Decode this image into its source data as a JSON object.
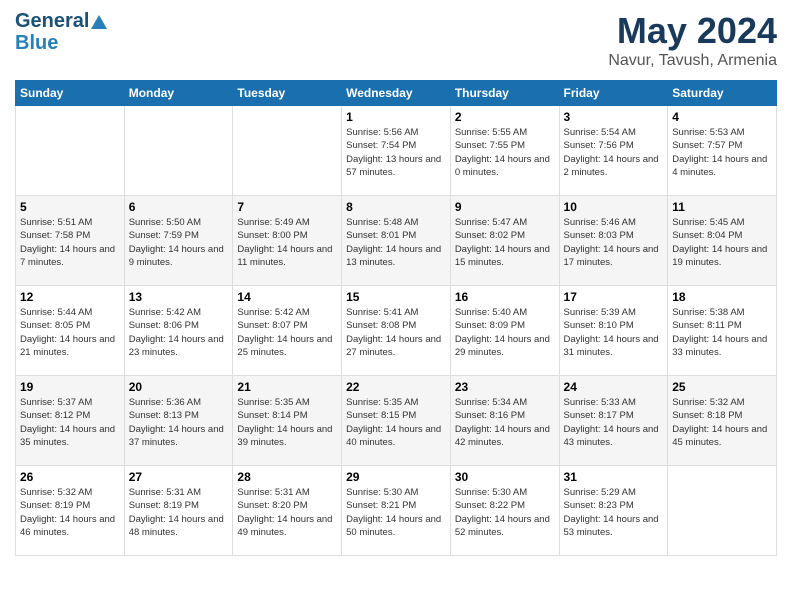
{
  "logo": {
    "line1": "General",
    "line2": "Blue"
  },
  "title": "May 2024",
  "subtitle": "Navur, Tavush, Armenia",
  "days_of_week": [
    "Sunday",
    "Monday",
    "Tuesday",
    "Wednesday",
    "Thursday",
    "Friday",
    "Saturday"
  ],
  "weeks": [
    [
      {
        "day": "",
        "sunrise": "",
        "sunset": "",
        "daylight": ""
      },
      {
        "day": "",
        "sunrise": "",
        "sunset": "",
        "daylight": ""
      },
      {
        "day": "",
        "sunrise": "",
        "sunset": "",
        "daylight": ""
      },
      {
        "day": "1",
        "sunrise": "Sunrise: 5:56 AM",
        "sunset": "Sunset: 7:54 PM",
        "daylight": "Daylight: 13 hours and 57 minutes."
      },
      {
        "day": "2",
        "sunrise": "Sunrise: 5:55 AM",
        "sunset": "Sunset: 7:55 PM",
        "daylight": "Daylight: 14 hours and 0 minutes."
      },
      {
        "day": "3",
        "sunrise": "Sunrise: 5:54 AM",
        "sunset": "Sunset: 7:56 PM",
        "daylight": "Daylight: 14 hours and 2 minutes."
      },
      {
        "day": "4",
        "sunrise": "Sunrise: 5:53 AM",
        "sunset": "Sunset: 7:57 PM",
        "daylight": "Daylight: 14 hours and 4 minutes."
      }
    ],
    [
      {
        "day": "5",
        "sunrise": "Sunrise: 5:51 AM",
        "sunset": "Sunset: 7:58 PM",
        "daylight": "Daylight: 14 hours and 7 minutes."
      },
      {
        "day": "6",
        "sunrise": "Sunrise: 5:50 AM",
        "sunset": "Sunset: 7:59 PM",
        "daylight": "Daylight: 14 hours and 9 minutes."
      },
      {
        "day": "7",
        "sunrise": "Sunrise: 5:49 AM",
        "sunset": "Sunset: 8:00 PM",
        "daylight": "Daylight: 14 hours and 11 minutes."
      },
      {
        "day": "8",
        "sunrise": "Sunrise: 5:48 AM",
        "sunset": "Sunset: 8:01 PM",
        "daylight": "Daylight: 14 hours and 13 minutes."
      },
      {
        "day": "9",
        "sunrise": "Sunrise: 5:47 AM",
        "sunset": "Sunset: 8:02 PM",
        "daylight": "Daylight: 14 hours and 15 minutes."
      },
      {
        "day": "10",
        "sunrise": "Sunrise: 5:46 AM",
        "sunset": "Sunset: 8:03 PM",
        "daylight": "Daylight: 14 hours and 17 minutes."
      },
      {
        "day": "11",
        "sunrise": "Sunrise: 5:45 AM",
        "sunset": "Sunset: 8:04 PM",
        "daylight": "Daylight: 14 hours and 19 minutes."
      }
    ],
    [
      {
        "day": "12",
        "sunrise": "Sunrise: 5:44 AM",
        "sunset": "Sunset: 8:05 PM",
        "daylight": "Daylight: 14 hours and 21 minutes."
      },
      {
        "day": "13",
        "sunrise": "Sunrise: 5:42 AM",
        "sunset": "Sunset: 8:06 PM",
        "daylight": "Daylight: 14 hours and 23 minutes."
      },
      {
        "day": "14",
        "sunrise": "Sunrise: 5:42 AM",
        "sunset": "Sunset: 8:07 PM",
        "daylight": "Daylight: 14 hours and 25 minutes."
      },
      {
        "day": "15",
        "sunrise": "Sunrise: 5:41 AM",
        "sunset": "Sunset: 8:08 PM",
        "daylight": "Daylight: 14 hours and 27 minutes."
      },
      {
        "day": "16",
        "sunrise": "Sunrise: 5:40 AM",
        "sunset": "Sunset: 8:09 PM",
        "daylight": "Daylight: 14 hours and 29 minutes."
      },
      {
        "day": "17",
        "sunrise": "Sunrise: 5:39 AM",
        "sunset": "Sunset: 8:10 PM",
        "daylight": "Daylight: 14 hours and 31 minutes."
      },
      {
        "day": "18",
        "sunrise": "Sunrise: 5:38 AM",
        "sunset": "Sunset: 8:11 PM",
        "daylight": "Daylight: 14 hours and 33 minutes."
      }
    ],
    [
      {
        "day": "19",
        "sunrise": "Sunrise: 5:37 AM",
        "sunset": "Sunset: 8:12 PM",
        "daylight": "Daylight: 14 hours and 35 minutes."
      },
      {
        "day": "20",
        "sunrise": "Sunrise: 5:36 AM",
        "sunset": "Sunset: 8:13 PM",
        "daylight": "Daylight: 14 hours and 37 minutes."
      },
      {
        "day": "21",
        "sunrise": "Sunrise: 5:35 AM",
        "sunset": "Sunset: 8:14 PM",
        "daylight": "Daylight: 14 hours and 39 minutes."
      },
      {
        "day": "22",
        "sunrise": "Sunrise: 5:35 AM",
        "sunset": "Sunset: 8:15 PM",
        "daylight": "Daylight: 14 hours and 40 minutes."
      },
      {
        "day": "23",
        "sunrise": "Sunrise: 5:34 AM",
        "sunset": "Sunset: 8:16 PM",
        "daylight": "Daylight: 14 hours and 42 minutes."
      },
      {
        "day": "24",
        "sunrise": "Sunrise: 5:33 AM",
        "sunset": "Sunset: 8:17 PM",
        "daylight": "Daylight: 14 hours and 43 minutes."
      },
      {
        "day": "25",
        "sunrise": "Sunrise: 5:32 AM",
        "sunset": "Sunset: 8:18 PM",
        "daylight": "Daylight: 14 hours and 45 minutes."
      }
    ],
    [
      {
        "day": "26",
        "sunrise": "Sunrise: 5:32 AM",
        "sunset": "Sunset: 8:19 PM",
        "daylight": "Daylight: 14 hours and 46 minutes."
      },
      {
        "day": "27",
        "sunrise": "Sunrise: 5:31 AM",
        "sunset": "Sunset: 8:19 PM",
        "daylight": "Daylight: 14 hours and 48 minutes."
      },
      {
        "day": "28",
        "sunrise": "Sunrise: 5:31 AM",
        "sunset": "Sunset: 8:20 PM",
        "daylight": "Daylight: 14 hours and 49 minutes."
      },
      {
        "day": "29",
        "sunrise": "Sunrise: 5:30 AM",
        "sunset": "Sunset: 8:21 PM",
        "daylight": "Daylight: 14 hours and 50 minutes."
      },
      {
        "day": "30",
        "sunrise": "Sunrise: 5:30 AM",
        "sunset": "Sunset: 8:22 PM",
        "daylight": "Daylight: 14 hours and 52 minutes."
      },
      {
        "day": "31",
        "sunrise": "Sunrise: 5:29 AM",
        "sunset": "Sunset: 8:23 PM",
        "daylight": "Daylight: 14 hours and 53 minutes."
      },
      {
        "day": "",
        "sunrise": "",
        "sunset": "",
        "daylight": ""
      }
    ]
  ]
}
